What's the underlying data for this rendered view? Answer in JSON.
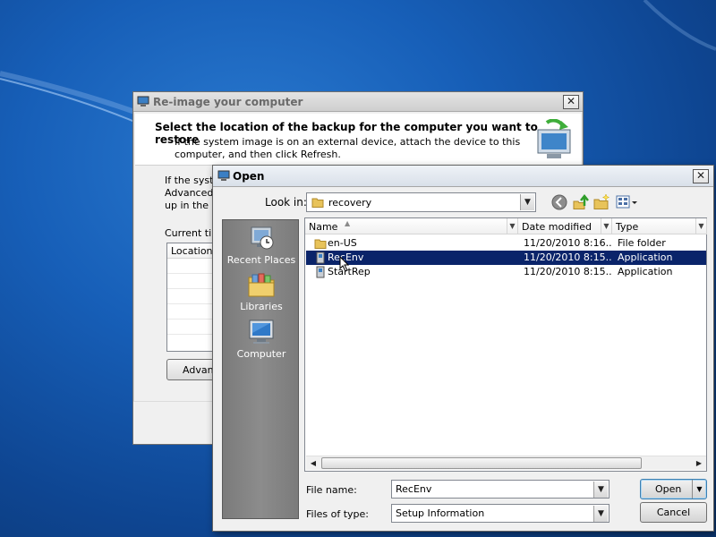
{
  "desktop": {
    "background_color": "#175fb8"
  },
  "reimage_window": {
    "title": "Re-image your computer",
    "header_title": "Select the location of the backup for the computer you want to restore",
    "header_subtitle": "If the system image is on an external device, attach the device to this computer, and then click Refresh.",
    "body_text_line1": "If the syste",
    "body_text_line2": "Advanced",
    "body_text_line3": "up in the lis",
    "current_label": "Current tim",
    "table_header": "Location",
    "advanced_button": "Advanc"
  },
  "open_dialog": {
    "title": "Open",
    "look_in_label": "Look in:",
    "look_in_value": "recovery",
    "places": [
      {
        "label": "Recent Places",
        "icon": "recent-places-icon"
      },
      {
        "label": "Libraries",
        "icon": "libraries-icon"
      },
      {
        "label": "Computer",
        "icon": "computer-icon"
      }
    ],
    "columns": {
      "name": "Name",
      "date": "Date modified",
      "type": "Type"
    },
    "files": [
      {
        "name": "en-US",
        "date": "11/20/2010 8:16...",
        "type": "File folder",
        "icon": "folder-icon",
        "selected": false
      },
      {
        "name": "RecEnv",
        "date": "11/20/2010 8:15...",
        "type": "Application",
        "icon": "application-icon",
        "selected": true
      },
      {
        "name": "StartRep",
        "date": "11/20/2010 8:15...",
        "type": "Application",
        "icon": "application-icon",
        "selected": false
      }
    ],
    "file_name_label": "File name:",
    "file_name_value": "RecEnv",
    "file_type_label": "Files of type:",
    "file_type_value": "Setup Information",
    "open_button": "Open",
    "cancel_button": "Cancel"
  },
  "colors": {
    "selection": "#0a246a",
    "places_bar": "#828282",
    "folder": "#e8c35a"
  }
}
